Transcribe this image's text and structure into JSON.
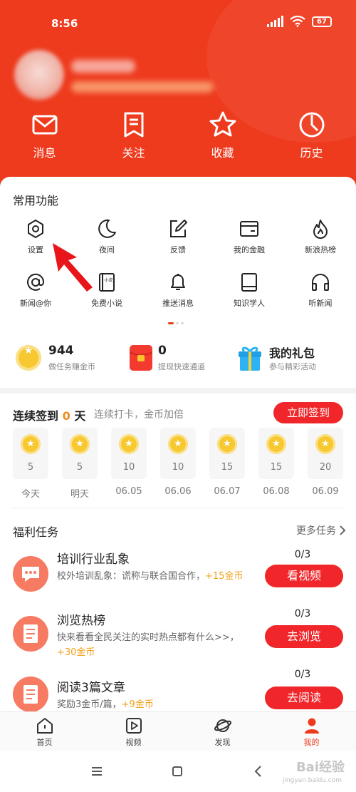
{
  "status": {
    "time": "8:56",
    "battery": "67"
  },
  "quick_actions": [
    {
      "label": "消息",
      "icon": "mail-icon"
    },
    {
      "label": "关注",
      "icon": "bookmark-icon"
    },
    {
      "label": "收藏",
      "icon": "star-icon"
    },
    {
      "label": "历史",
      "icon": "clock-icon"
    }
  ],
  "common": {
    "title": "常用功能",
    "items": [
      {
        "label": "设置",
        "icon": "settings-icon"
      },
      {
        "label": "夜间",
        "icon": "moon-icon"
      },
      {
        "label": "反馈",
        "icon": "edit-icon"
      },
      {
        "label": "我的金融",
        "icon": "wallet-icon"
      },
      {
        "label": "新浪热榜",
        "icon": "flame-icon"
      },
      {
        "label": "新闻@你",
        "icon": "at-icon"
      },
      {
        "label": "免费小说",
        "icon": "book-icon"
      },
      {
        "label": "推送消息",
        "icon": "bell-icon"
      },
      {
        "label": "知识学人",
        "icon": "notebook-icon"
      },
      {
        "label": "听新闻",
        "icon": "headphones-icon"
      }
    ],
    "novel_icon_text": "小说"
  },
  "stats": {
    "coins": {
      "value": "944",
      "desc": "做任务赚金币"
    },
    "cash": {
      "value": "0",
      "desc": "提现快速通道"
    },
    "gift": {
      "label": "我的礼包",
      "desc": "参与精彩活动"
    }
  },
  "signin": {
    "title_prefix": "连续签到",
    "days": "0",
    "title_suffix": "天",
    "subtitle": "连续打卡，金币加倍",
    "button": "立即签到",
    "cards": [
      {
        "value": "5",
        "day": "今天"
      },
      {
        "value": "5",
        "day": "明天"
      },
      {
        "value": "10",
        "day": "06.05"
      },
      {
        "value": "10",
        "day": "06.06"
      },
      {
        "value": "15",
        "day": "06.07"
      },
      {
        "value": "15",
        "day": "06.08"
      },
      {
        "value": "20",
        "day": "06.09"
      }
    ]
  },
  "welfare": {
    "title": "福利任务",
    "more": "更多任务",
    "tasks": [
      {
        "title": "培训行业乱象",
        "desc": "校外培训乱象：谎称与联合国合作，",
        "reward": "+15金币",
        "count": "0/3",
        "button": "看视频",
        "icon": "chat-icon"
      },
      {
        "title": "浏览热榜",
        "desc": "快来看看全民关注的实时热点都有什么>>，",
        "reward": "+30金币",
        "count": "0/3",
        "button": "去浏览",
        "icon": "document-icon"
      },
      {
        "title": "阅读3篇文章",
        "desc": "奖励3金币/篇，",
        "reward": "+9金币",
        "count": "0/3",
        "button": "去阅读",
        "icon": "document-icon"
      }
    ]
  },
  "bottom_nav": [
    {
      "label": "首页",
      "icon": "home-icon"
    },
    {
      "label": "视频",
      "icon": "video-icon"
    },
    {
      "label": "发现",
      "icon": "planet-icon"
    },
    {
      "label": "我的",
      "icon": "person-icon"
    }
  ],
  "watermark": {
    "main": "Bai经验",
    "sub": "jingyan.baidu.com"
  },
  "colors": {
    "brand": "#ee3a1d",
    "button": "#f0262a",
    "reward": "#f0a018",
    "coin": "#f7c82f"
  }
}
